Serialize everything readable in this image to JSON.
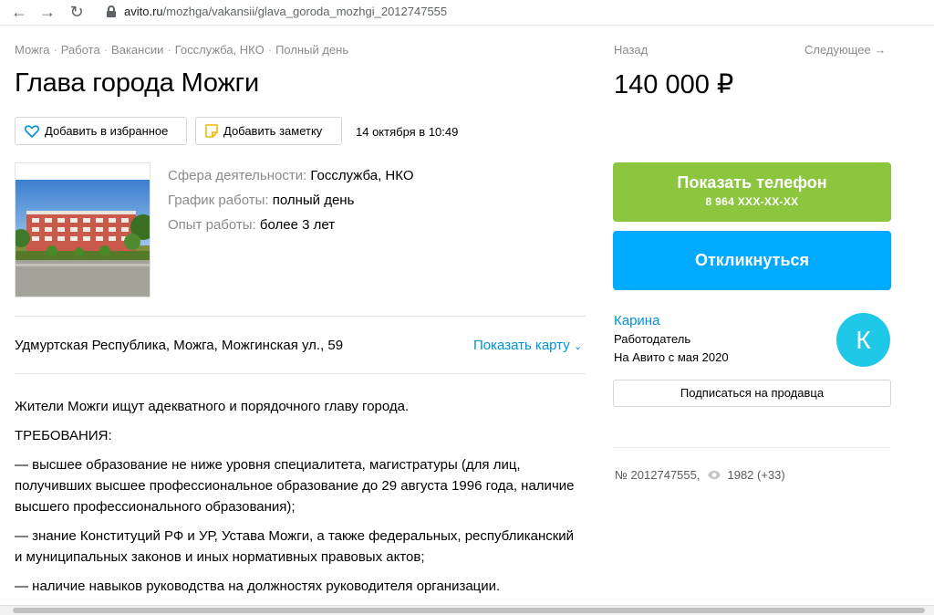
{
  "browser": {
    "url_host": "avito.ru",
    "url_path": "/mozhga/vakansii/glava_goroda_mozhgi_2012747555"
  },
  "breadcrumb": [
    "Можга",
    "Работа",
    "Вакансии",
    "Госслужба, НКО",
    "Полный день"
  ],
  "nav": {
    "prev": "Назад",
    "next": "Следующее →"
  },
  "listing": {
    "title": "Глава города Можги",
    "price": "140 000 ₽",
    "favorite_label": "Добавить в избранное",
    "note_label": "Добавить заметку",
    "date": "14 октября в 10:49",
    "params": [
      {
        "key": "Сфера деятельности:",
        "value": "Госслужба, НКО"
      },
      {
        "key": "График работы:",
        "value": "полный день"
      },
      {
        "key": "Опыт работы:",
        "value": "более 3 лет"
      }
    ],
    "address": "Удмуртская Республика, Можга, Можгинская ул., 59",
    "map_link": "Показать карту",
    "description": [
      "Жители Можги ищут адекватного и порядочного главу города.",
      "ТРЕБОВАНИЯ:",
      "— высшее образование не ниже уровня специалитета, магистратуры (для лиц, получивших высшее профессиональное образование до 29 августа 1996 года, наличие высшего профессионального образования);",
      "— знание Конституций РФ и УР, Устава Можги, а также федеральных, республиканский и муниципальных законов и иных нормативных правовых актов;",
      "— наличие навыков руководства на должностях руководителя организации."
    ]
  },
  "actions": {
    "show_phone": "Показать телефон",
    "phone_masked": "8 964 XXX-XX-XX",
    "reply": "Откликнуться",
    "subscribe": "Подписаться на продавца"
  },
  "seller": {
    "name": "Карина",
    "role": "Работодатель",
    "since": "На Авито с мая 2020",
    "avatar_letter": "К"
  },
  "ad_meta": {
    "number": "№ 2012747555,",
    "views": "1982 (+33)"
  },
  "colors": {
    "phone_button": "#8cc63f",
    "reply_button": "#00aaff",
    "link": "#0091d9",
    "avatar": "#1ec8e6"
  }
}
